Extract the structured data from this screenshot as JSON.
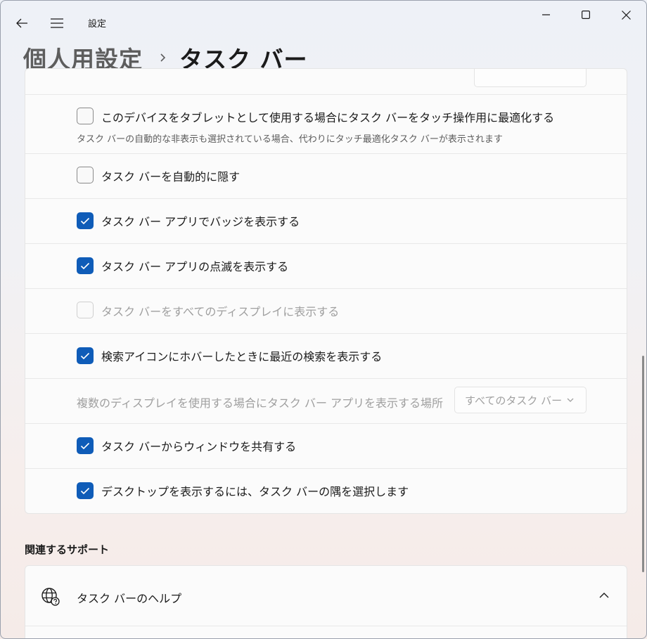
{
  "app": {
    "title": "設定"
  },
  "breadcrumb": {
    "parent": "個人用設定",
    "current": "タスク バー"
  },
  "settings": [
    {
      "label": "このデバイスをタブレットとして使用する場合にタスク バーをタッチ操作用に最適化する",
      "state": "unchecked",
      "subtitle": "タスク バーの自動的な非表示も選択されている場合、代わりにタッチ最適化タスク バーが表示されます"
    },
    {
      "label": "タスク バーを自動的に隠す",
      "state": "unchecked"
    },
    {
      "label": "タスク バー アプリでバッジを表示する",
      "state": "checked"
    },
    {
      "label": "タスク バー アプリの点滅を表示する",
      "state": "checked"
    },
    {
      "label": "タスク バーをすべてのディスプレイに表示する",
      "state": "disabled-unchecked"
    },
    {
      "label": "検索アイコンにホバーしたときに最近の検索を表示する",
      "state": "checked"
    },
    {
      "label": "複数のディスプレイを使用する場合にタスク バー アプリを表示する場所",
      "state": "disabled",
      "dropdown_value": "すべてのタスク バー"
    },
    {
      "label": "タスク バーからウィンドウを共有する",
      "state": "checked"
    },
    {
      "label": "デスクトップを表示するには、タスク バーの隅を選択します",
      "state": "checked"
    }
  ],
  "related_support": {
    "title": "関連するサポート",
    "help_item": {
      "label": "タスク バーのヘルプ",
      "expanded": true
    }
  },
  "icons": {
    "back": "back-arrow-icon",
    "menu": "hamburger-icon",
    "minimize": "minimize-icon",
    "maximize": "maximize-icon",
    "close": "close-icon",
    "globe": "globe-help-icon",
    "chevron_up": "chevron-up-icon",
    "chevron_down": "chevron-down-icon",
    "checkmark": "checkmark-icon"
  },
  "colors": {
    "accent": "#0f5cb8",
    "disabled_text": "#9f9f9f"
  }
}
